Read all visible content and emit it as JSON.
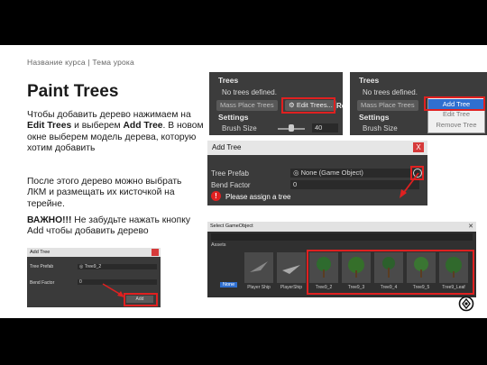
{
  "slide": {
    "breadcrumb": "Название курса | Тема урока",
    "title": "Paint Trees",
    "para1_a": "Чтобы добавить дерево нажимаем на ",
    "para1_b": "Edit Trees",
    "para1_c": " и выберем ",
    "para1_d": "Add Tree",
    "para1_e": ". В новом окне выберем модель дерева, которую хотим добавить",
    "para2": "После этого дерево можно выбрать ЛКМ и размещать их кисточкой на терейне.",
    "para3_bold": "ВАЖНО!!!",
    "para3_rest": " Не забудьте нажать кнопку Add чтобы добавить дерево"
  },
  "trees_panel": {
    "title": "Trees",
    "no_trees": "No trees defined.",
    "mass_place": "Mass Place Trees",
    "edit_trees": "Edit Trees...",
    "partial": "Re",
    "settings": "Settings",
    "brush_size_label": "Brush Size",
    "brush_size_value": "40"
  },
  "trees_menu": {
    "title": "Trees",
    "no_trees": "No trees defined.",
    "mass_place": "Mass Place Trees",
    "settings": "Settings",
    "brush_size_label": "Brush Size",
    "items": [
      "Add Tree",
      "Edit Tree",
      "Remove Tree"
    ]
  },
  "add_tree_dialog": {
    "title": "Add Tree",
    "close": "X",
    "prefab_label": "Tree Prefab",
    "prefab_value": "None (Game Object)",
    "bend_label": "Bend Factor",
    "bend_value": "0",
    "warning": "Please assign a tree"
  },
  "small_dialog": {
    "title": "Add Tree",
    "prefab_label": "Tree Prefab",
    "prefab_value": "Tree9_2",
    "bend_label": "Bend Factor",
    "bend_value": "0",
    "add_button": "Add"
  },
  "select_dialog": {
    "title": "Select GameObject",
    "tab": "Assets",
    "items": [
      "None",
      "Player Ship",
      "PlayerShip",
      "Tree9_2",
      "Tree9_3",
      "Tree9_4",
      "Tree9_5",
      "Tree9_Leaf"
    ]
  },
  "colors": {
    "accent_red": "#e02020",
    "panel_bg": "#3c3c3c",
    "selected_blue": "#2f6fd0"
  }
}
